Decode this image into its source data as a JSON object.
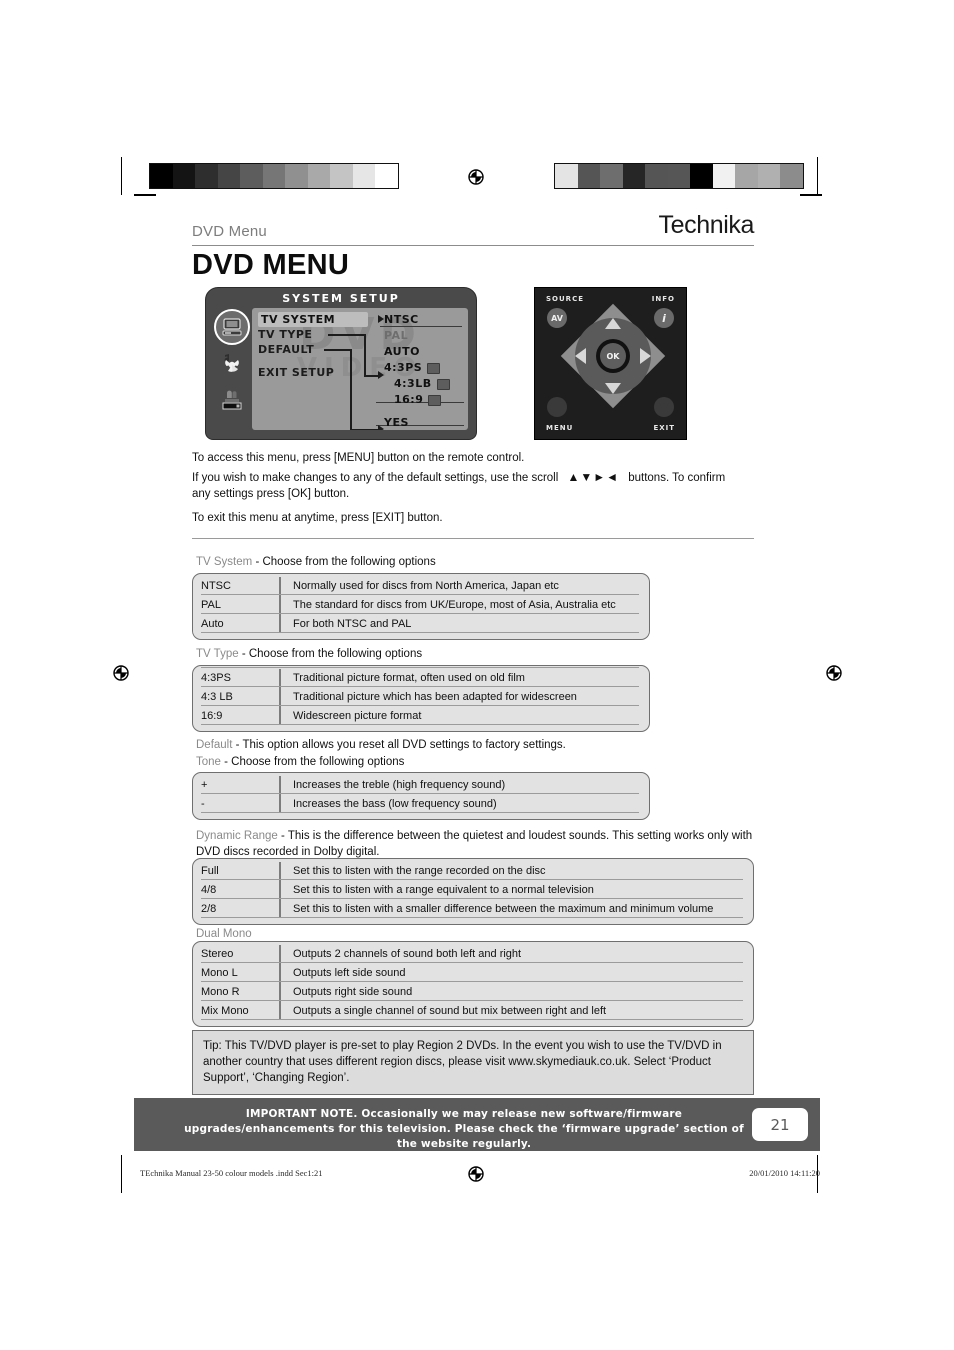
{
  "header": {
    "section_label": "DVD Menu",
    "brand": "Technika",
    "page_title": "DVD MENU"
  },
  "osd": {
    "title": "SYSTEM SETUP",
    "watermark_line1": "DVD",
    "watermark_line2": "VIDEO",
    "left_menu": [
      {
        "label": "TV SYSTEM",
        "selected": true
      },
      {
        "label": "TV TYPE",
        "selected": false
      },
      {
        "label": "DEFAULT",
        "selected": false
      },
      {
        "label": "EXIT SETUP",
        "selected": false
      }
    ],
    "right_options": [
      {
        "label": "NTSC",
        "dim": false,
        "icon": false
      },
      {
        "label": "PAL",
        "dim": true,
        "icon": false
      },
      {
        "label": "AUTO",
        "dim": false,
        "icon": false
      },
      {
        "label": "4:3PS",
        "dim": false,
        "icon": true
      },
      {
        "label": "4:3LB",
        "dim": false,
        "icon": true
      },
      {
        "label": "16:9",
        "dim": false,
        "icon": true
      },
      {
        "label": "YES",
        "dim": false,
        "icon": false
      }
    ],
    "sidebar_icons": [
      "tv-monitor-icon",
      "audio-music-icon",
      "speaker-level-icon"
    ]
  },
  "remote": {
    "source_label": "SOURCE",
    "source_button": "AV",
    "info_label": "INFO",
    "info_button": "i",
    "ok_button": "OK",
    "menu_label": "MENU",
    "exit_label": "EXIT"
  },
  "intro": {
    "line1": "To access this menu, press [MENU] button on the remote control.",
    "line2_a": "If you wish to make changes to any of the default settings, use the scroll",
    "scroll_glyphs": "▲▼►◄",
    "line2_b": "buttons. To confirm",
    "line2_c": "any settings press [OK] button.",
    "line3": "To exit this menu at anytime, press [EXIT] button."
  },
  "sections": [
    {
      "key": "TV System",
      "desc": "- Choose from the following options",
      "rows": [
        {
          "option": "NTSC",
          "description": "Normally used for discs from North America, Japan etc"
        },
        {
          "option": "PAL",
          "description": "The standard for discs from UK/Europe, most of Asia, Australia etc"
        },
        {
          "option": "Auto",
          "description": "For both NTSC and PAL"
        }
      ]
    },
    {
      "key": "TV Type",
      "desc": "- Choose from the following options",
      "rows": [
        {
          "option": "4:3PS",
          "description": "Traditional picture format, often used on old film"
        },
        {
          "option": "4:3 LB",
          "description": "Traditional picture which has been adapted for widescreen"
        },
        {
          "option": "16:9",
          "description": "Widescreen picture format"
        }
      ]
    },
    {
      "key": "Tone",
      "desc": "- Choose from the following options",
      "rows": [
        {
          "option": "+",
          "description": "Increases the treble (high frequency sound)"
        },
        {
          "option": "-",
          "description": "Increases the bass (low frequency sound)"
        }
      ]
    },
    {
      "key": "Dynamic Range",
      "desc": "",
      "rows": [
        {
          "option": "Full",
          "description": "Set this to listen with the range recorded on the disc"
        },
        {
          "option": "4/8",
          "description": "Set this to listen with a range equivalent to a normal television"
        },
        {
          "option": "2/8",
          "description": "Set this to listen with a smaller difference between the maximum and minimum volume"
        }
      ]
    },
    {
      "key": "Dual Mono",
      "desc": "",
      "rows": [
        {
          "option": "Stereo",
          "description": "Outputs 2 channels of sound both left and right"
        },
        {
          "option": "Mono L",
          "description": "Outputs left side sound"
        },
        {
          "option": "Mono R",
          "description": "Outputs right side sound"
        },
        {
          "option": "Mix Mono",
          "description": "Outputs a single channel of sound but mix between right and left"
        }
      ]
    }
  ],
  "default_section": {
    "key": "Default",
    "desc": "- This option allows you reset all DVD settings to factory settings."
  },
  "dynamic_range_intro": {
    "key": "Dynamic Range",
    "desc_line1": "- This is the difference between the quietest and loudest sounds. This setting works only",
    "desc_line2": "with DVD discs recorded in Dolby digital."
  },
  "dual_mono_label": "Dual Mono",
  "tip": {
    "text": "Tip: This TV/DVD player is pre-set to play Region 2 DVDs. In the event you wish to use the TV/DVD in another country that uses different region discs, please visit www.skymediauk.co.uk. Select ‘Product Support’, ‘Changing Region’."
  },
  "note_bar": {
    "line1": "IMPORTANT NOTE. Occasionally we may release new software/firmware upgrades/enhancements",
    "line2": "for this television. Please check the ‘firmware upgrade’ section of the website regularly.",
    "page_number": "21"
  },
  "print_footer": {
    "left": "TEchnika Manual 23-50 colour models .indd   Sec1:21",
    "right": "20/01/2010   14:11:20"
  },
  "calibration": {
    "left_swatches": [
      "#000000",
      "#141414",
      "#2e2e2e",
      "#454545",
      "#5d5d5d",
      "#767676",
      "#909090",
      "#a9a9a9",
      "#c4c4c4",
      "#e6e6e6",
      "#ffffff"
    ],
    "right_swatches": [
      "#e4e4e4",
      "#555555",
      "#6e6e6e",
      "#262626",
      "#555555",
      "#565656",
      "#000000",
      "#f1f1f1",
      "#a6a6a6",
      "#b0b0b0",
      "#8c8c8c"
    ]
  },
  "colors": {
    "note_bar_bg": "#5a5a5a",
    "table_bg": "#e2e2e2",
    "tip_bg": "#dcdcdc",
    "section_key": "#8a8a8a"
  }
}
